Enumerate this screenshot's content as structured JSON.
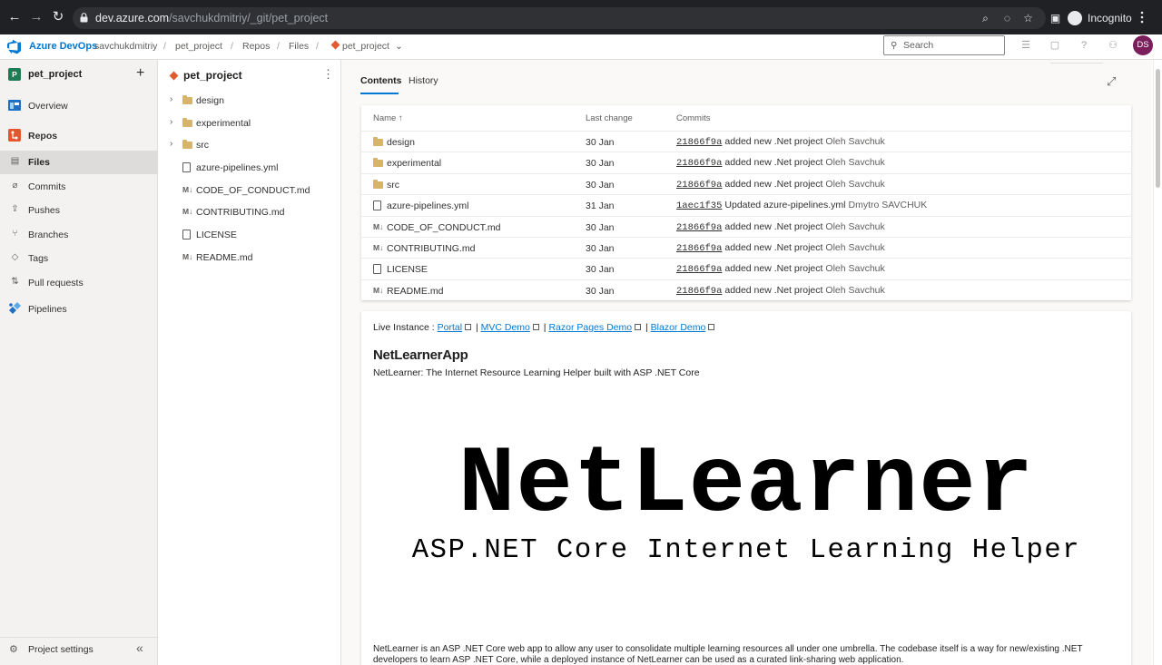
{
  "browser": {
    "url_host": "dev.azure.com",
    "url_path": "/savchukdmitriy/_git/pet_project",
    "profile_label": "Incognito"
  },
  "header": {
    "brand": "Azure DevOps",
    "breadcrumb": [
      "savchukdmitriy",
      "Repos",
      "Files"
    ],
    "org": "savchukdmitriy",
    "project": "pet_project",
    "section": "Repos",
    "page": "Files",
    "repo": "pet_project",
    "search_placeholder": "Search",
    "avatar_initials": "DS"
  },
  "leftnav": {
    "project_initial": "P",
    "project_name": "pet_project",
    "items": [
      {
        "label": "Overview"
      },
      {
        "label": "Repos"
      },
      {
        "label": "Files"
      },
      {
        "label": "Commits"
      },
      {
        "label": "Pushes"
      },
      {
        "label": "Branches"
      },
      {
        "label": "Tags"
      },
      {
        "label": "Pull requests"
      },
      {
        "label": "Pipelines"
      }
    ],
    "settings_label": "Project settings"
  },
  "tree": {
    "title": "pet_project",
    "items": [
      {
        "label": "design"
      },
      {
        "label": "experimental"
      },
      {
        "label": "src"
      },
      {
        "label": "azure-pipelines.yml"
      },
      {
        "label": "CODE_OF_CONDUCT.md"
      },
      {
        "label": "CONTRIBUTING.md"
      },
      {
        "label": "LICENSE"
      },
      {
        "label": "README.md"
      }
    ]
  },
  "main": {
    "tabs": [
      "Contents",
      "History"
    ],
    "columns": {
      "name": "Name ↑",
      "last_change": "Last change",
      "commits": "Commits"
    },
    "rows": [
      {
        "name": "design",
        "date": "30 Jan",
        "hash": "21866f9a",
        "message": "added new .Net project",
        "author": "Oleh Savchuk"
      },
      {
        "name": "experimental",
        "date": "30 Jan",
        "hash": "21866f9a",
        "message": "added new .Net project",
        "author": "Oleh Savchuk"
      },
      {
        "name": "src",
        "date": "30 Jan",
        "hash": "21866f9a",
        "message": "added new .Net project",
        "author": "Oleh Savchuk"
      },
      {
        "name": "azure-pipelines.yml",
        "date": "31 Jan",
        "hash": "1aec1f35",
        "message": "Updated azure-pipelines.yml",
        "author": "Dmytro SAVCHUK"
      },
      {
        "name": "CODE_OF_CONDUCT.md",
        "date": "30 Jan",
        "hash": "21866f9a",
        "message": "added new .Net project",
        "author": "Oleh Savchuk"
      },
      {
        "name": "CONTRIBUTING.md",
        "date": "30 Jan",
        "hash": "21866f9a",
        "message": "added new .Net project",
        "author": "Oleh Savchuk"
      },
      {
        "name": "LICENSE",
        "date": "30 Jan",
        "hash": "21866f9a",
        "message": "added new .Net project",
        "author": "Oleh Savchuk"
      },
      {
        "name": "README.md",
        "date": "30 Jan",
        "hash": "21866f9a",
        "message": "added new .Net project",
        "author": "Oleh Savchuk"
      }
    ]
  },
  "readme": {
    "live_prefix": "Live Instance : ",
    "links": [
      "Portal",
      "MVC Demo",
      "Razor Pages Demo",
      "Blazor Demo"
    ],
    "separator": " | ",
    "title": "NetLearnerApp",
    "subtitle": "NetLearner: The Internet Resource Learning Helper built with ASP .NET Core",
    "logo_text": "NetLearner",
    "logo_tagline": "ASP.NET Core Internet Learning Helper",
    "paragraph": "NetLearner is an ASP .NET Core web app to allow any user to consolidate multiple learning resources all under one umbrella. The codebase itself is a way for new/existing .NET developers to learn ASP .NET Core, while a deployed instance of NetLearner can be used as a curated link-sharing web application."
  }
}
